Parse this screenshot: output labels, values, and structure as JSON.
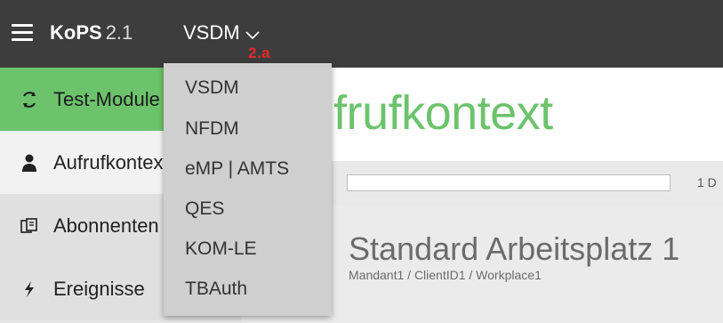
{
  "header": {
    "app_name": "KoPS",
    "version": "2.1",
    "context_selector": "VSDM",
    "annotation": "2.a"
  },
  "dropdown": {
    "items": [
      "VSDM",
      "NFDM",
      "eMP | AMTS",
      "QES",
      "KOM-LE",
      "TBAuth"
    ]
  },
  "sidebar": {
    "items": [
      {
        "label": "Test-Module",
        "icon": "test-modules-icon"
      },
      {
        "label": "Aufrufkontext",
        "icon": "user-icon"
      },
      {
        "label": "Abonnenten",
        "icon": "subscribers-icon"
      },
      {
        "label": "Ereignisse",
        "icon": "lightning-icon"
      }
    ]
  },
  "main": {
    "title": "Aufrufkontext",
    "strip_text": "1 D",
    "workplace_title": "Standard Arbeitsplatz 1",
    "workplace_path": "Mandant1 / ClientID1 / Workplace1"
  },
  "colors": {
    "topbar": "#3d3d3d",
    "accent_green": "#6cc36c",
    "annotation_red": "#e8262a",
    "dropdown_bg": "#cfcfcf"
  }
}
